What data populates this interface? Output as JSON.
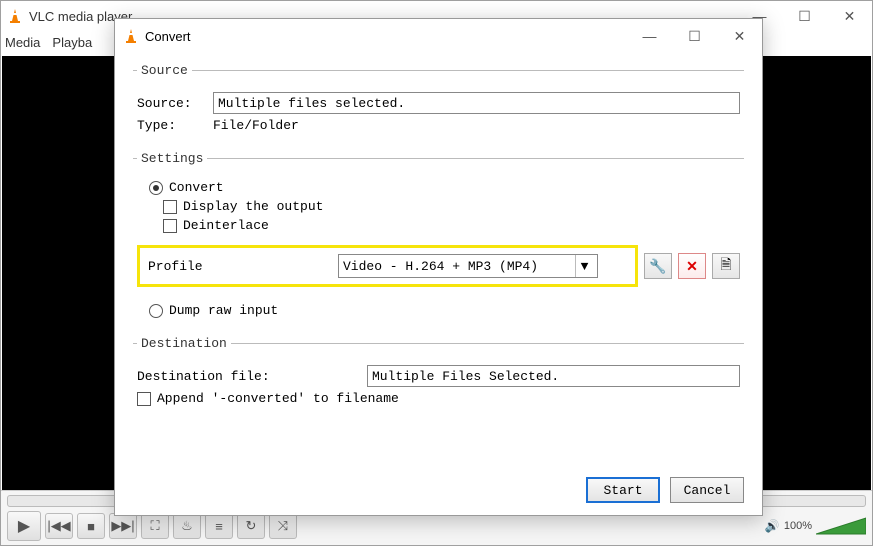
{
  "main": {
    "title": "VLC media player",
    "menu": {
      "media": "Media",
      "playback": "Playba"
    },
    "volume_text": "100%"
  },
  "dialog": {
    "title": "Convert",
    "source": {
      "legend": "Source",
      "source_label": "Source:",
      "source_value": "Multiple files selected.",
      "type_label": "Type:",
      "type_value": "File/Folder"
    },
    "settings": {
      "legend": "Settings",
      "convert": "Convert",
      "display_output": "Display the output",
      "deinterlace": "Deinterlace",
      "profile_label": "Profile",
      "profile_value": "Video - H.264 + MP3 (MP4)",
      "dump_raw": "Dump raw input"
    },
    "destination": {
      "legend": "Destination",
      "file_label": "Destination file:",
      "file_value": "Multiple Files Selected.",
      "append": "Append '-converted' to filename"
    },
    "buttons": {
      "start": "Start",
      "cancel": "Cancel"
    }
  }
}
